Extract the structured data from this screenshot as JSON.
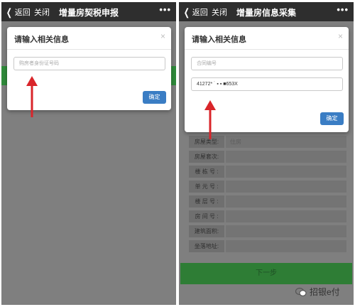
{
  "left_screen": {
    "nav": {
      "back_label": "返回",
      "close_label": "关闭",
      "title": "增量房契税申报",
      "more_label": "•••"
    },
    "modal": {
      "title": "请输入相关信息",
      "close_label": "×",
      "id_placeholder": "购房者身份证号码",
      "confirm_label": "确定"
    }
  },
  "right_screen": {
    "nav": {
      "back_label": "返回",
      "close_label": "关闭",
      "title": "增量房信息采集",
      "more_label": "•••"
    },
    "modal": {
      "title": "请输入相关信息",
      "close_label": "×",
      "contract_placeholder": "合同编号",
      "id_value": "41272* ˙ ▪ ▪ ■653X",
      "confirm_label": "确定"
    },
    "form": {
      "rows": [
        {
          "label": "房屋类型:",
          "value": "住房"
        },
        {
          "label": "房屋套次:",
          "value": ""
        },
        {
          "label": "楼 栋 号 :",
          "value": ""
        },
        {
          "label": "单 元 号 :",
          "value": ""
        },
        {
          "label": "楼 层 号 :",
          "value": ""
        },
        {
          "label": "房 间 号 :",
          "value": ""
        },
        {
          "label": "建筑面积:",
          "value": ""
        },
        {
          "label": "坐落地址:",
          "value": ""
        }
      ],
      "next_label": "下一步"
    }
  },
  "watermark": {
    "text": "招银e付"
  },
  "colors": {
    "nav_bg": "#2e2e2e",
    "accent_blue": "#3a7dc4",
    "arrow_red": "#d9252a",
    "green": "#2f8a3a"
  }
}
